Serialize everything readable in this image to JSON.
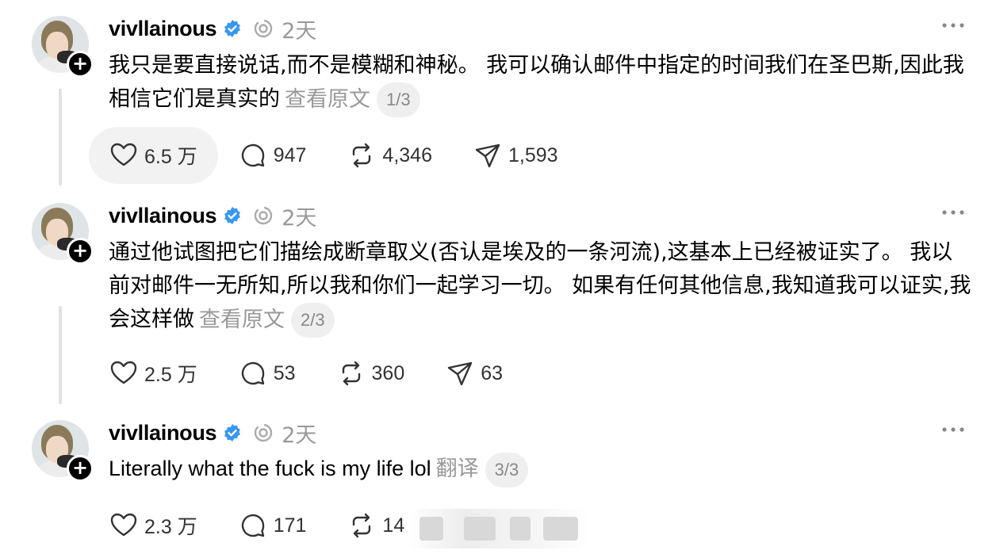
{
  "posts": [
    {
      "username": "vivllainous",
      "time": "2天",
      "text": "我只是要直接说话,而不是模糊和神秘。 我可以确认邮件中指定的时间我们在圣巴斯,因此我相信它们是真实的",
      "see_original": "查看原文",
      "page": "1/3",
      "likes": "6.5 万",
      "replies": "947",
      "reposts": "4,346",
      "shares": "1,593"
    },
    {
      "username": "vivllainous",
      "time": "2天",
      "text": "通过他试图把它们描绘成断章取义(否认是埃及的一条河流),这基本上已经被证实了。 我以前对邮件一无所知,所以我和你们一起学习一切。 如果有任何其他信息,我知道我可以证实,我会这样做",
      "see_original": "查看原文",
      "page": "2/3",
      "likes": "2.5 万",
      "replies": "53",
      "reposts": "360",
      "shares": "63"
    },
    {
      "username": "vivllainous",
      "time": "2天",
      "text": "Literally what the fuck is my life lol",
      "see_original": "翻译",
      "page": "3/3",
      "likes": "2.3 万",
      "replies": "171",
      "reposts": "14"
    }
  ],
  "colors": {
    "verified": "#3897f0",
    "muted": "#999999",
    "liked_bg": "#f2f2f2"
  },
  "icons": [
    "verified-badge-icon",
    "activity-icon",
    "more-icon",
    "heart-icon",
    "reply-icon",
    "repost-icon",
    "share-icon",
    "follow-plus-icon"
  ]
}
